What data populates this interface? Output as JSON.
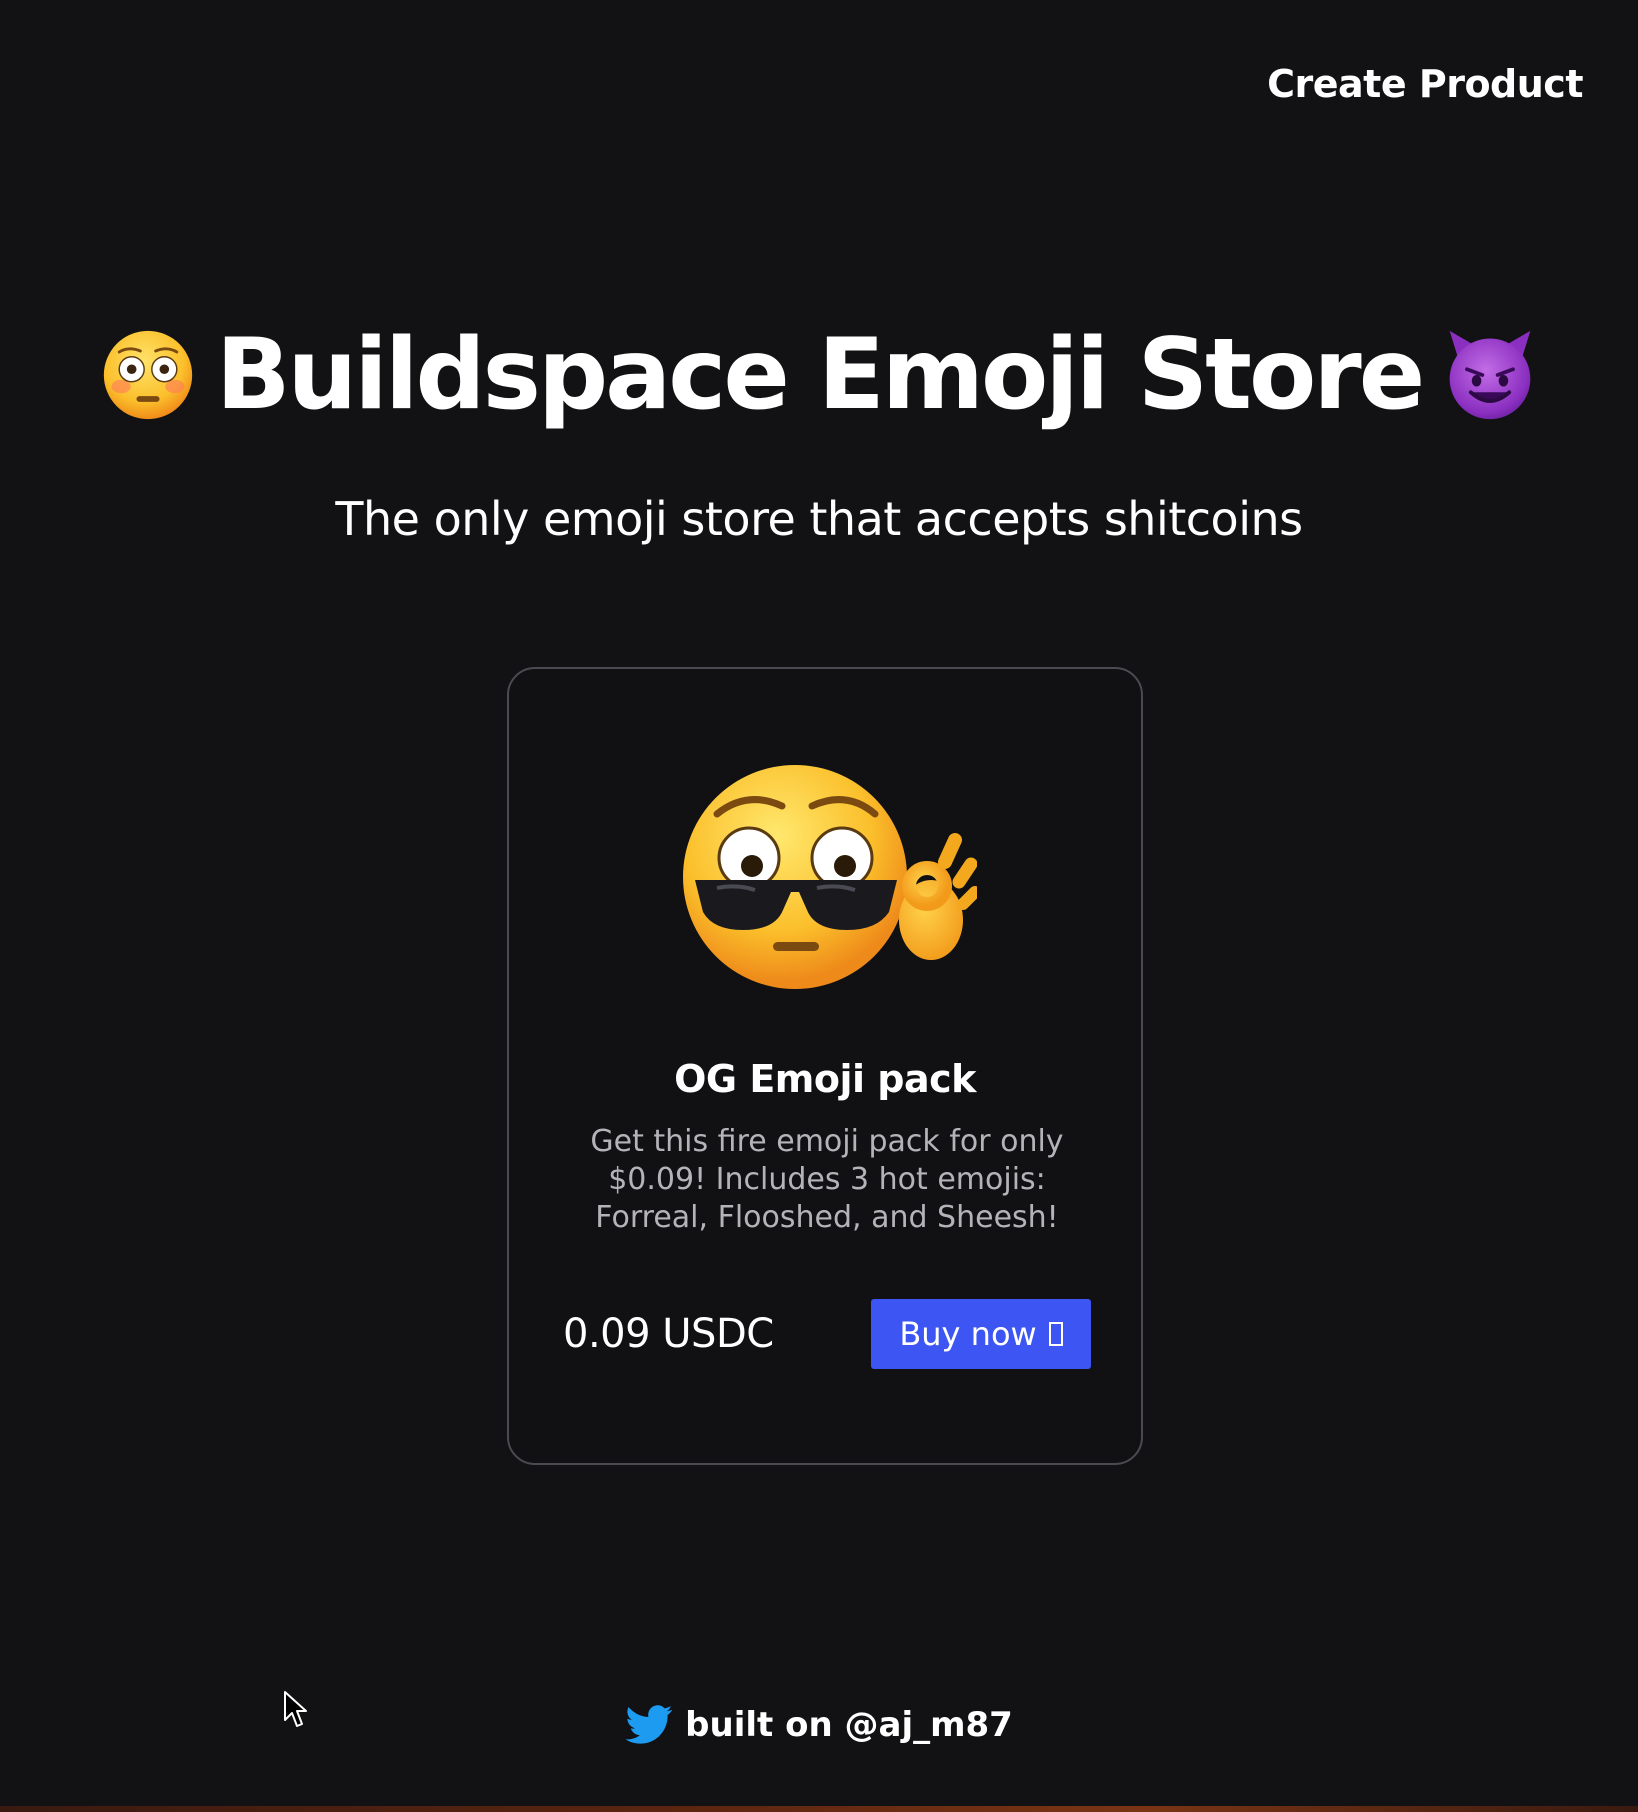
{
  "nav": {
    "create_product_label": "Create Product"
  },
  "hero": {
    "title": "Buildspace Emoji Store",
    "left_emoji_icon": "flushed-face-emoji",
    "right_emoji_icon": "smiling-devil-emoji",
    "subtitle": "The only emoji store that accepts shitcoins"
  },
  "product": {
    "image_icon": "flushed-face-with-sunglasses-ok-hand-emoji",
    "name": "OG Emoji pack",
    "description": "Get this fire emoji pack for only $0.09! Includes 3 hot emojis: Forreal, Flooshed, and Sheesh!",
    "price": "0.09 USDC",
    "buy_label": "Buy now",
    "buy_icon": "missing-glyph-box",
    "button_color": "#3d55f2"
  },
  "footer": {
    "icon": "twitter-bird-icon",
    "text": "built on @aj_m87",
    "icon_color": "#1d9bf0"
  },
  "colors": {
    "background": "#121214",
    "card_border": "#4a4a50",
    "text": "#ffffff",
    "muted_text": "#b4b4b8"
  }
}
